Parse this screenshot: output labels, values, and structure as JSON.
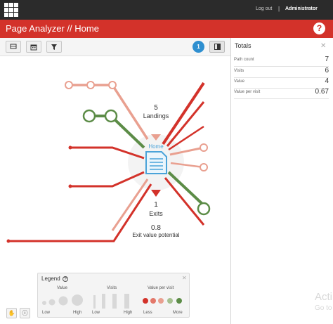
{
  "topbar": {
    "logout": "Log out",
    "separator": "|",
    "user": "Administrator"
  },
  "header": {
    "title": "Page Analyzer // Home",
    "help": "?"
  },
  "toolbar": {
    "badge": "1"
  },
  "totals": {
    "title": "Totals",
    "rows": [
      {
        "label": "Path count",
        "value": "7"
      },
      {
        "label": "Visits",
        "value": "6"
      },
      {
        "label": "Value",
        "value": "4"
      },
      {
        "label": "Value per visit",
        "value": "0.67"
      }
    ]
  },
  "center": {
    "landings_count": "5",
    "landings_label": "Landings",
    "page": "Home",
    "exits_count": "1",
    "exits_label": "Exits",
    "exit_value": "0.8",
    "exit_value_label": "Exit value potential"
  },
  "legend": {
    "title": "Legend",
    "value": "Value",
    "visits": "Visits",
    "value_per_visit": "Value per visit",
    "low": "Low",
    "high": "High",
    "less": "Less",
    "more": "More"
  },
  "watermark": {
    "line1": "Acti",
    "line2": "Go to"
  },
  "colors": {
    "red": "#d3322a",
    "salmon": "#e9a090",
    "green": "#5c8c47",
    "blue": "#2e8fd0",
    "doc": "#4aa3d9"
  },
  "icons": [
    "app-grid-icon",
    "help-icon",
    "flag-icon",
    "calendar-icon",
    "filter-icon",
    "panel-icon",
    "document-icon",
    "hand-icon",
    "info-icon"
  ]
}
